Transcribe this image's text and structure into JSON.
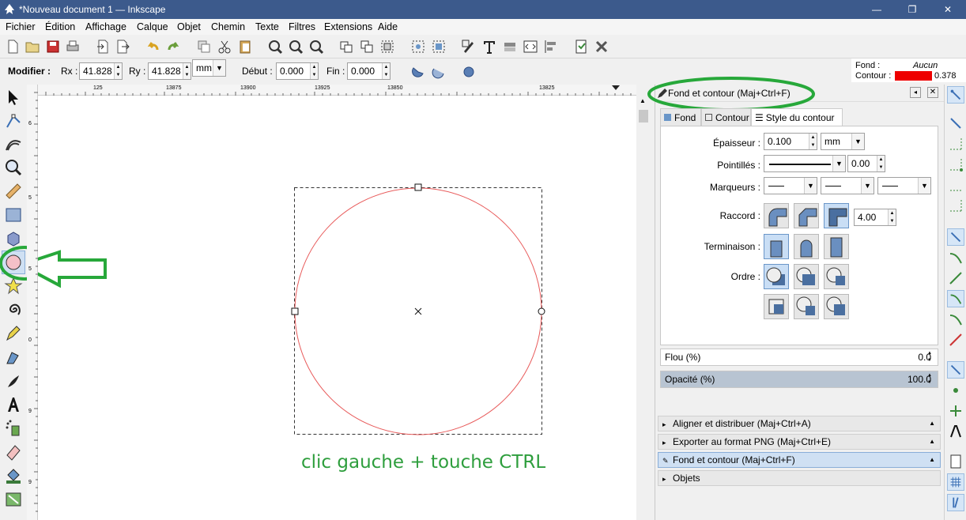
{
  "window": {
    "title": "*Nouveau document 1 — Inkscape",
    "controls": {
      "minimize": "—",
      "maximize": "❐",
      "close": "✕"
    }
  },
  "menu": [
    "Fichier",
    "Édition",
    "Affichage",
    "Calque",
    "Objet",
    "Chemin",
    "Texte",
    "Filtres",
    "Extensions",
    "Aide"
  ],
  "tool_controls": {
    "modifier_label": "Modifier :",
    "rx_label": "Rx :",
    "rx_value": "41.828",
    "ry_label": "Ry :",
    "ry_value": "41.828",
    "unit": "mm",
    "start_label": "Début :",
    "start_value": "0.000",
    "end_label": "Fin :",
    "end_value": "0.000"
  },
  "fill_stroke_indicator": {
    "fill_label": "Fond :",
    "fill_value": "Aucun",
    "stroke_label": "Contour :",
    "stroke_color": "#ee0000",
    "stroke_width": "0.378"
  },
  "rulers": {
    "horizontal": [
      "125",
      "13875",
      "13900",
      "13925",
      "13850",
      "13825"
    ],
    "vertical_marks": [
      "6",
      "1",
      "5",
      "9",
      "7",
      "5",
      "5",
      "2",
      "9",
      "0",
      "5",
      "2",
      "5",
      "9",
      "5",
      "5",
      "5",
      "9",
      "5",
      "1"
    ]
  },
  "canvas": {
    "ellipse_stroke": "#e85a5a",
    "annotation_text": "clic gauche + touche CTRL",
    "annotation_color": "#2e9e3d"
  },
  "dock": {
    "header_title": "Fond et contour (Maj+Ctrl+F)",
    "tabs": [
      "Fond",
      "Contour",
      "Style du contour"
    ],
    "width_label": "Épaisseur :",
    "width_value": "0.100",
    "width_unit": "mm",
    "dash_label": "Pointillés :",
    "dash_offset": "0.00",
    "markers_label": "Marqueurs :",
    "join_label": "Raccord :",
    "miter_value": "4.00",
    "cap_label": "Terminaison :",
    "order_label": "Ordre :",
    "blur_label": "Flou (%)",
    "blur_value": "0.0",
    "opacity_label": "Opacité (%)",
    "opacity_value": "100.0",
    "collapsed_panels": [
      "Aligner et distribuer (Maj+Ctrl+A)",
      "Exporter au format PNG (Maj+Ctrl+E)",
      "Fond et contour (Maj+Ctrl+F)",
      "Objets"
    ]
  }
}
